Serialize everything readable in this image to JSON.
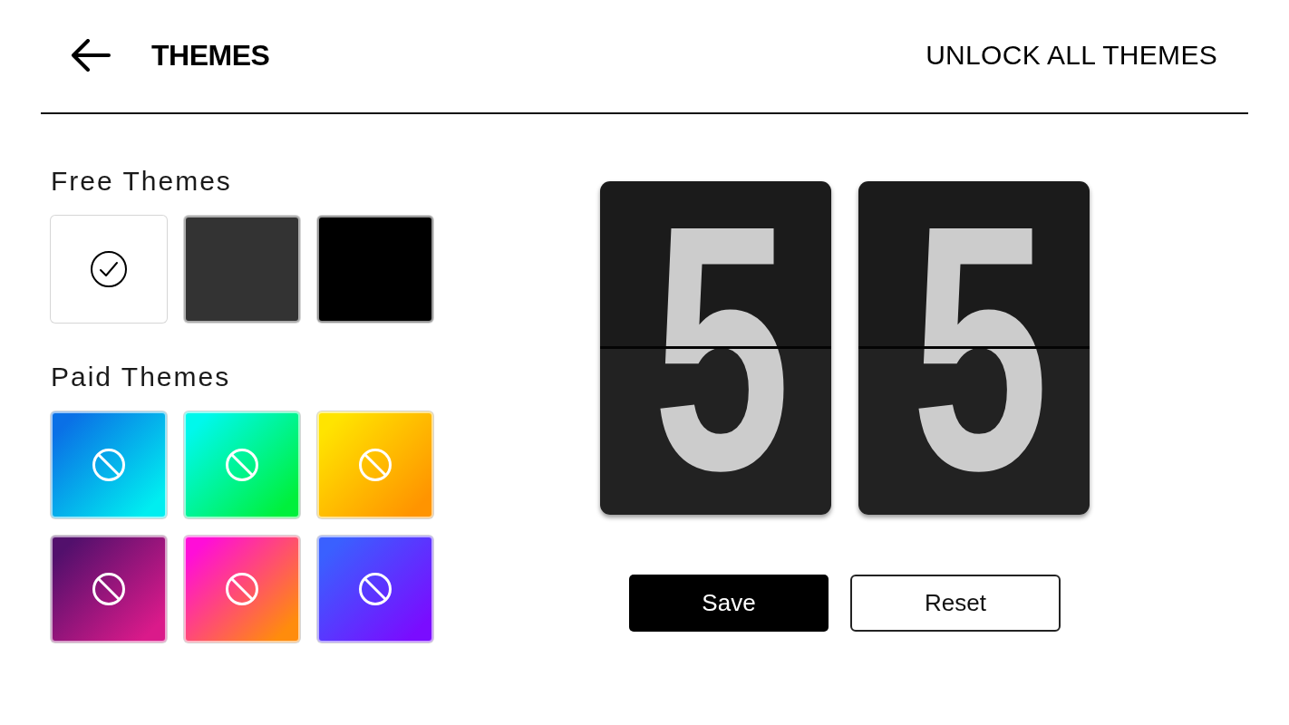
{
  "header": {
    "title": "THEMES",
    "action": "UNLOCK ALL THEMES"
  },
  "free_themes": {
    "heading": "Free Themes",
    "items": [
      {
        "gradient": [
          {
            "color": "#ffffff"
          }
        ],
        "selected": true,
        "locked": false
      },
      {
        "gradient": [
          {
            "color": "#333333"
          }
        ],
        "selected": false,
        "locked": false
      },
      {
        "gradient": [
          {
            "color": "#000000"
          }
        ],
        "selected": false,
        "locked": false
      }
    ]
  },
  "paid_themes": {
    "heading": "Paid Themes",
    "items": [
      {
        "gradient": [
          {
            "color": "#0a70e6"
          },
          {
            "color": "#00eef0"
          }
        ],
        "selected": false,
        "locked": true
      },
      {
        "gradient": [
          {
            "color": "#00f8ec"
          },
          {
            "color": "#00f03c"
          }
        ],
        "selected": false,
        "locked": true
      },
      {
        "gradient": [
          {
            "color": "#ffe400"
          },
          {
            "color": "#ff9400"
          }
        ],
        "selected": false,
        "locked": true
      },
      {
        "gradient": [
          {
            "color": "#52106c"
          },
          {
            "color": "#da1a8a"
          }
        ],
        "selected": false,
        "locked": true
      },
      {
        "gradient": [
          {
            "color": "#ff0ed8"
          },
          {
            "color": "#ff8c0c"
          }
        ],
        "selected": false,
        "locked": true
      },
      {
        "gradient": [
          {
            "color": "#3a60ff"
          },
          {
            "color": "#7a0cff"
          }
        ],
        "selected": false,
        "locked": true
      }
    ]
  },
  "preview": {
    "digits": [
      "5",
      "5"
    ]
  },
  "buttons": [
    {
      "label": "Save",
      "kind": "primary"
    },
    {
      "label": "Reset",
      "kind": "outline"
    }
  ]
}
